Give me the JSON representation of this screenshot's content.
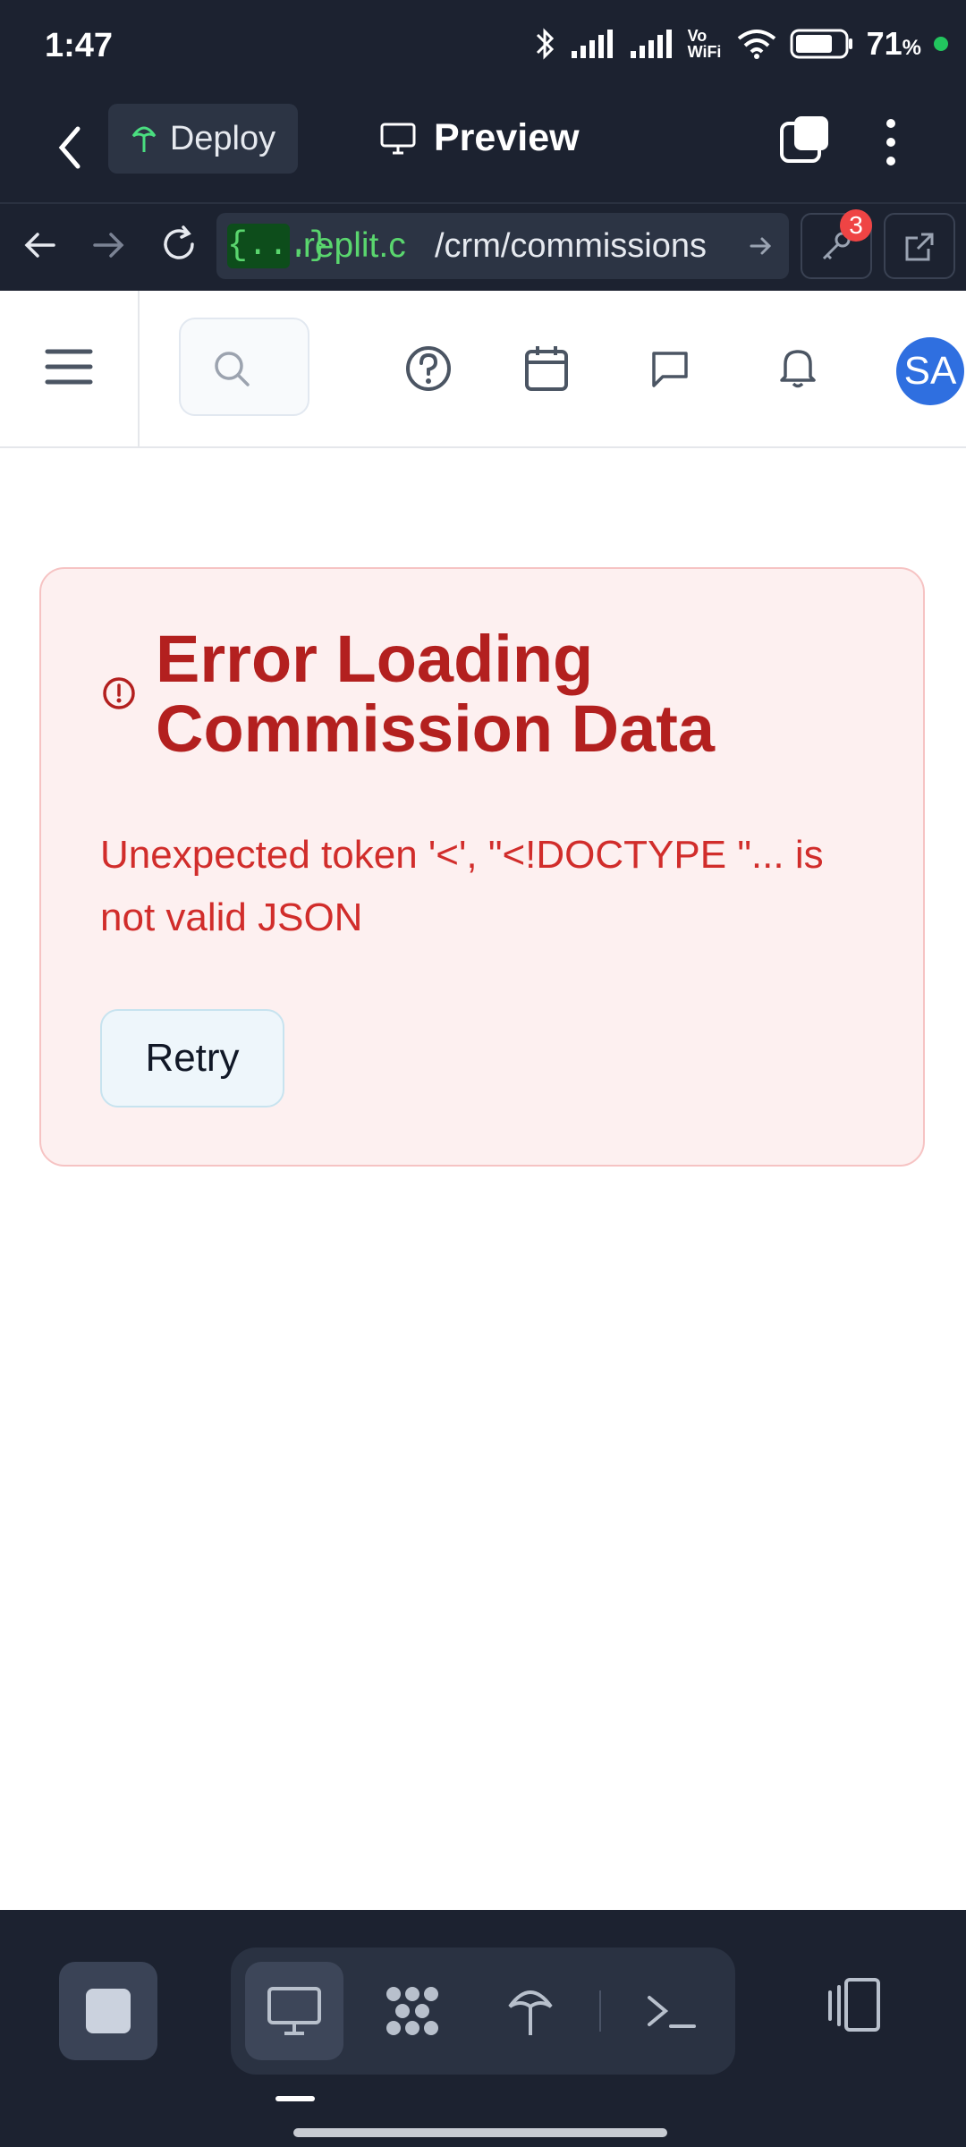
{
  "status": {
    "time": "1:47",
    "battery": "71",
    "battery_unit": "%",
    "wifi_label": "Vo WiFi"
  },
  "header": {
    "deploy_label": "Deploy",
    "preview_label": "Preview"
  },
  "urlbar": {
    "host_tag": "{...}",
    "host": ".replit.c",
    "path": "/crm/commissions",
    "key_badge": "3"
  },
  "crm": {
    "avatar_initials": "SA"
  },
  "error": {
    "title": "Error Loading Commission Data",
    "message": "Unexpected token '<', \"<!DOCTYPE \"... is not valid JSON",
    "retry_label": "Retry"
  },
  "colors": {
    "dark_bg": "#1c2230",
    "error_text": "#b3201f",
    "error_bg": "#fdf0f0",
    "accent_blue": "#2f6fe0",
    "url_green": "#5ad66e"
  },
  "icons": [
    "back-icon",
    "deploy-icon",
    "monitor-icon",
    "tabs-icon",
    "kebab-icon",
    "nav-back-icon",
    "nav-forward-icon",
    "reload-icon",
    "arrow-right-icon",
    "key-icon",
    "external-link-icon",
    "menu-icon",
    "search-icon",
    "help-icon",
    "calendar-icon",
    "chat-icon",
    "bell-icon",
    "alert-circle-icon",
    "stop-icon",
    "desktop-icon",
    "workflow-icon",
    "deploy-tree-icon",
    "terminal-icon",
    "device-rotate-icon"
  ]
}
